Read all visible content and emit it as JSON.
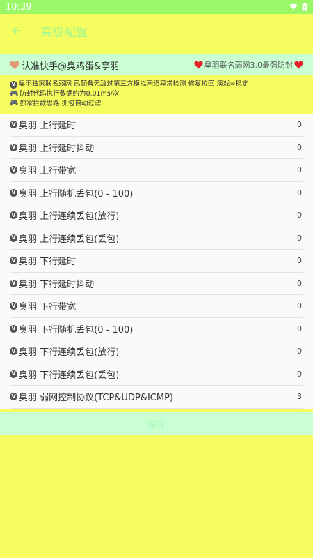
{
  "status_bar": {
    "time": "10:39"
  },
  "app_bar": {
    "title": "高级配置"
  },
  "banner": {
    "left_text": "认准快手@臭鸡蛋&亭羽",
    "right_text": "臭羽联名弱网3.0最强防封"
  },
  "notes": [
    "臭羽独家联名弱网 已配备无敌过第三方模拟网络异常检测 修复拉回 演戏=稳定",
    "防封代码执行数据约为0.01ms/次",
    "独家拦截思路 抓包自动过滤"
  ],
  "settings": [
    {
      "label": "臭羽 上行延时",
      "value": "0"
    },
    {
      "label": "臭羽 上行延时抖动",
      "value": "0"
    },
    {
      "label": "臭羽 上行带宽",
      "value": "0"
    },
    {
      "label": "臭羽 上行随机丢包(0 - 100)",
      "value": "0"
    },
    {
      "label": "臭羽 上行连续丢包(放行)",
      "value": "0"
    },
    {
      "label": "臭羽 上行连续丢包(丢包)",
      "value": "0"
    },
    {
      "label": "臭羽 下行延时",
      "value": "0"
    },
    {
      "label": "臭羽 下行延时抖动",
      "value": "0"
    },
    {
      "label": "臭羽 下行带宽",
      "value": "0"
    },
    {
      "label": "臭羽 下行随机丢包(0 - 100)",
      "value": "0"
    },
    {
      "label": "臭羽 下行连续丢包(放行)",
      "value": "0"
    },
    {
      "label": "臭羽 下行连续丢包(丢包)",
      "value": "0"
    },
    {
      "label": "臭羽 弱网控制协议(TCP&UDP&ICMP)",
      "value": "3"
    }
  ],
  "save_button": {
    "label": "保存"
  },
  "icons": {
    "back": "arrow-left-icon",
    "heart_brown": "heart-icon",
    "heart_red": "heart-icon",
    "v_badge": "v-icon",
    "gamepad": "gamepad-icon"
  },
  "colors": {
    "background": "#F6FD5E",
    "status_bar": "#9AF868",
    "banner": "#C9FFD3",
    "list_bg": "#FAFAFA",
    "heart_left": "#E2967A",
    "heart_right": "#E8202A"
  }
}
